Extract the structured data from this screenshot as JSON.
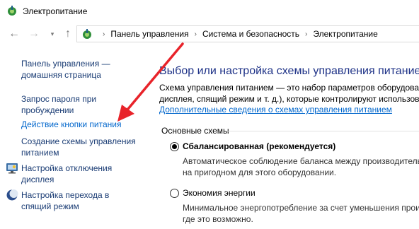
{
  "window": {
    "title": "Электропитание",
    "icon": "power-options-icon"
  },
  "navbar": {
    "back_icon": "arrow-left-icon",
    "forward_icon": "arrow-right-icon",
    "recent_icon": "chevron-down-icon",
    "up_icon": "arrow-up-icon",
    "breadcrumbs": [
      "Панель управления",
      "Система и безопасность",
      "Электропитание"
    ],
    "separator": "›"
  },
  "sidebar": {
    "items": [
      {
        "line1": "Панель управления —",
        "line2": "домашняя страница",
        "icon": null
      },
      {
        "line1": "Запрос пароля при",
        "line2": "пробуждении",
        "icon": null
      },
      {
        "line1": "Действие кнопки питания",
        "line2": "",
        "icon": null
      },
      {
        "line1": "Создание схемы управления",
        "line2": "питанием",
        "icon": null
      },
      {
        "line1": "Настройка отключения",
        "line2": "дисплея",
        "icon": "display-monitor-icon"
      },
      {
        "line1": "Настройка перехода в",
        "line2": "спящий режим",
        "icon": "moon-sleep-icon"
      }
    ]
  },
  "main": {
    "heading": "Выбор или настройка схемы управления питанием",
    "description_line1": "Схема управления питанием — это набор параметров оборудования",
    "description_line2": "дисплея, спящий режим и т. д.), которые контролируют использов",
    "more_link": "Дополнительные сведения о схемах управления питанием",
    "group_label": "Основные схемы",
    "plans": [
      {
        "name": "Сбалансированная (рекомендуется)",
        "selected": true,
        "desc_line1": "Автоматическое соблюдение баланса между производительность",
        "desc_line2": "на пригодном для этого оборудовании."
      },
      {
        "name": "Экономия энергии",
        "selected": false,
        "desc_line1": "Минимальное энергопотребление за счет уменьшения произво",
        "desc_line2": "где это возможно."
      }
    ]
  },
  "colors": {
    "link": "#0066cc",
    "sidebar_text": "#1a3c74",
    "heading": "#1e3287",
    "annotation_arrow": "#e8232a"
  }
}
